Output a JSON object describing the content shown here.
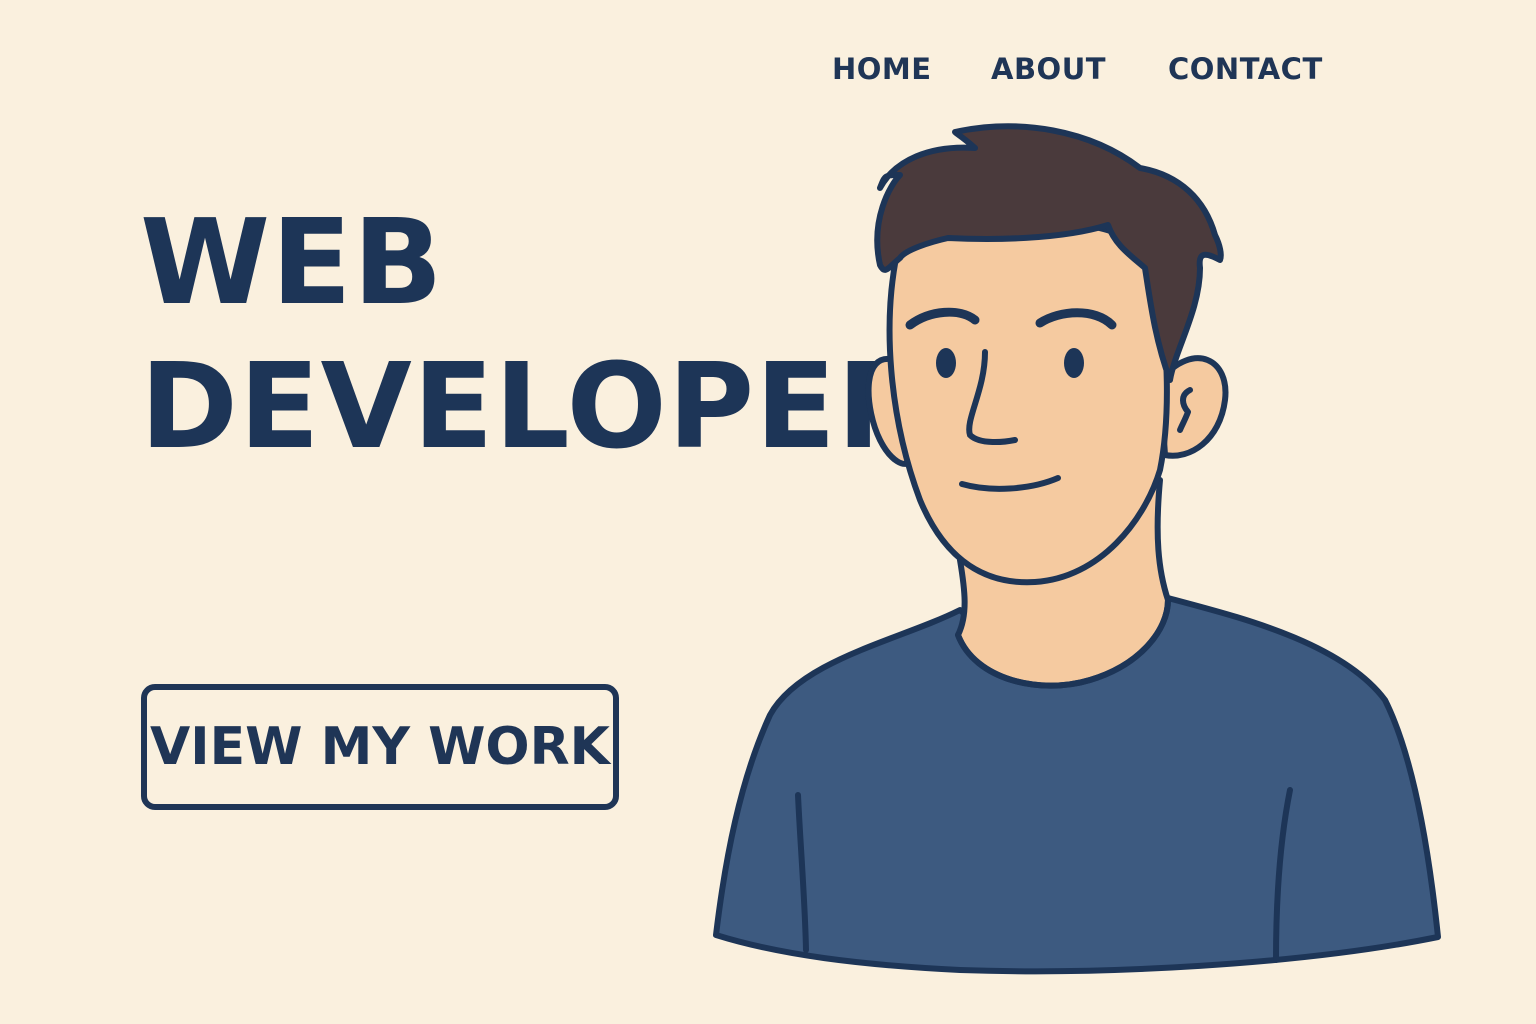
{
  "nav": {
    "items": [
      {
        "label": "HOME"
      },
      {
        "label": "ABOUT"
      },
      {
        "label": "CONTACT"
      }
    ]
  },
  "hero": {
    "title_line1": "WEB",
    "title_line2": "DEVELOPER",
    "cta_label": "VIEW MY WORK"
  },
  "illustration": {
    "icon": "developer-avatar-illustration",
    "colors": {
      "background": "#faf0de",
      "outline": "#1d3557",
      "skin": "#f5caa0",
      "hair": "#4a3a3c",
      "shirt": "#3d5a80"
    }
  }
}
